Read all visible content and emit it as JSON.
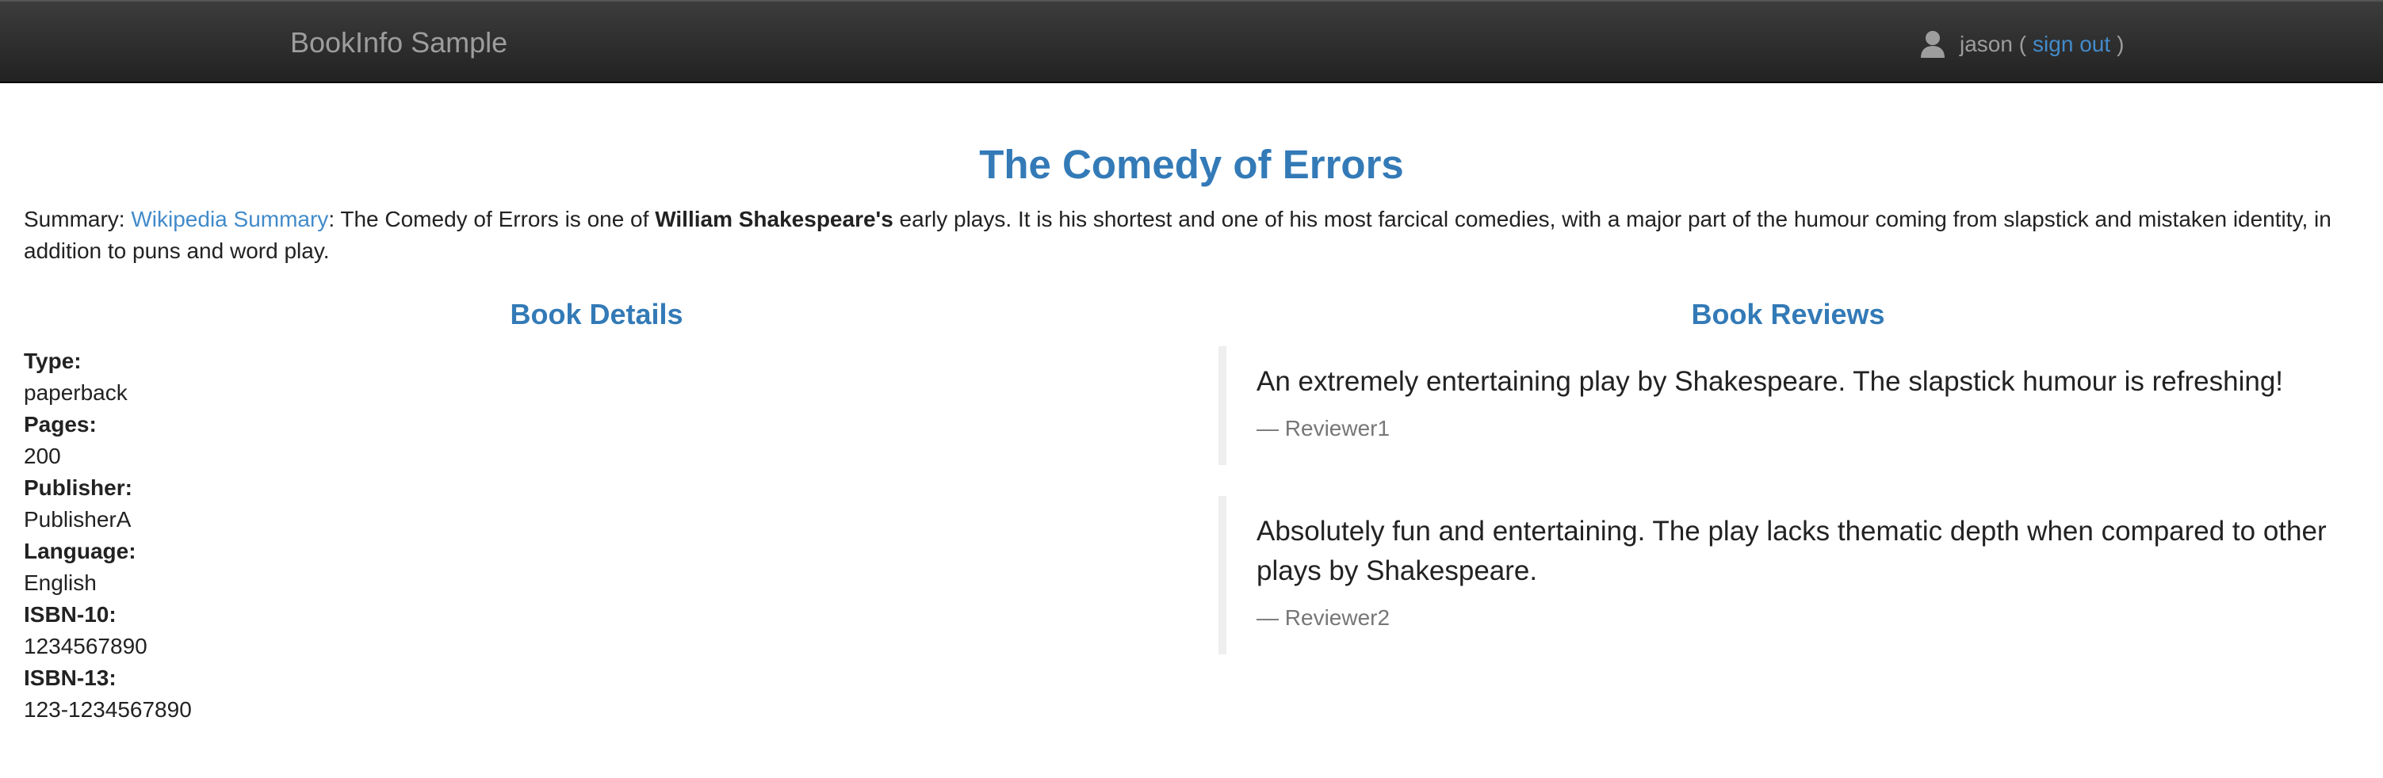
{
  "navbar": {
    "brand": "BookInfo Sample",
    "user": {
      "icon": "user-icon",
      "name": "jason",
      "open_paren": "(",
      "signout_label": "sign out",
      "close_paren": ")"
    }
  },
  "book": {
    "title": "The Comedy of Errors",
    "summary": {
      "label": "Summary:",
      "link_text": "Wikipedia Summary",
      "text_before_author": ": The Comedy of Errors is one of",
      "author": "William Shakespeare's",
      "text_after_author": "early plays. It is his shortest and one of his most farcical comedies, with a major part of the humour coming from slapstick and mistaken identity, in addition to puns and word play."
    }
  },
  "details": {
    "heading": "Book Details",
    "items": [
      {
        "label": "Type:",
        "value": "paperback"
      },
      {
        "label": "Pages:",
        "value": "200"
      },
      {
        "label": "Publisher:",
        "value": "PublisherA"
      },
      {
        "label": "Language:",
        "value": "English"
      },
      {
        "label": "ISBN-10:",
        "value": "1234567890"
      },
      {
        "label": "ISBN-13:",
        "value": "123-1234567890"
      }
    ]
  },
  "reviews": {
    "heading": "Book Reviews",
    "items": [
      {
        "text": "An extremely entertaining play by Shakespeare. The slapstick humour is refreshing!",
        "author": "— Reviewer1"
      },
      {
        "text": "Absolutely fun and entertaining. The play lacks thematic depth when compared to other plays by Shakespeare.",
        "author": "— Reviewer2"
      }
    ]
  },
  "colors": {
    "navbar_bg": "#222222",
    "accent": "#337ab7",
    "link": "#428bca",
    "muted": "#9d9d9d"
  }
}
